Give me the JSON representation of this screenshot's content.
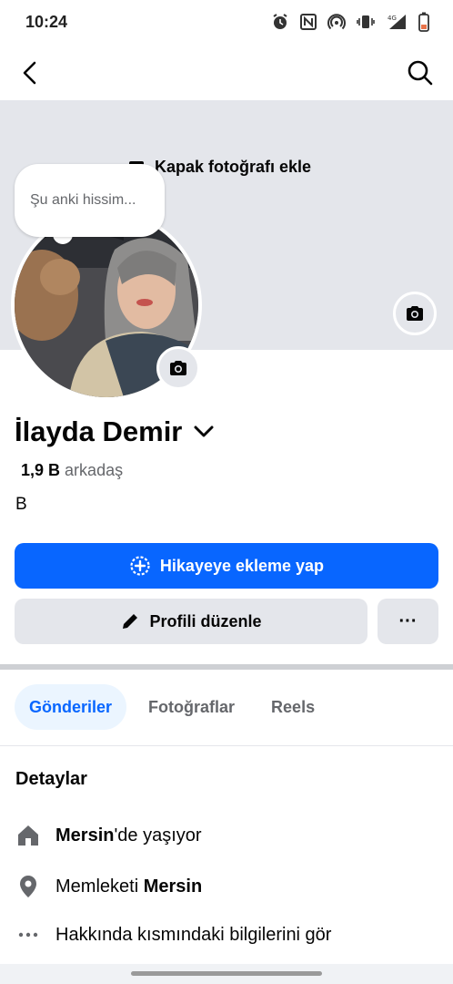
{
  "status_bar": {
    "time": "10:24",
    "network": "4G"
  },
  "cover": {
    "add_label": "Kapak fotoğrafı ekle"
  },
  "note_bubble": {
    "placeholder": "Şu anki hissim..."
  },
  "profile": {
    "name": "İlayda Demir",
    "friends_count": "1,9 B",
    "friends_label": "arkadaş",
    "bio": "B"
  },
  "actions": {
    "story_label": "Hikayeye ekleme yap",
    "edit_label": "Profili düzenle",
    "more_label": "···"
  },
  "tabs": [
    {
      "label": "Gönderiler",
      "active": true
    },
    {
      "label": "Fotoğraflar",
      "active": false
    },
    {
      "label": "Reels",
      "active": false
    }
  ],
  "details": {
    "title": "Detaylar",
    "lives_in_city": "Mersin",
    "lives_in_suffix": "'de yaşıyor",
    "hometown_prefix": "Memleketi ",
    "hometown_city": "Mersin",
    "about_link": "Hakkında kısmındaki bilgilerini gör"
  },
  "colors": {
    "accent": "#0866ff",
    "cover_bg": "#e4e6eb",
    "secondary_text": "#65676b",
    "active_tab_bg": "#ebf5ff"
  }
}
